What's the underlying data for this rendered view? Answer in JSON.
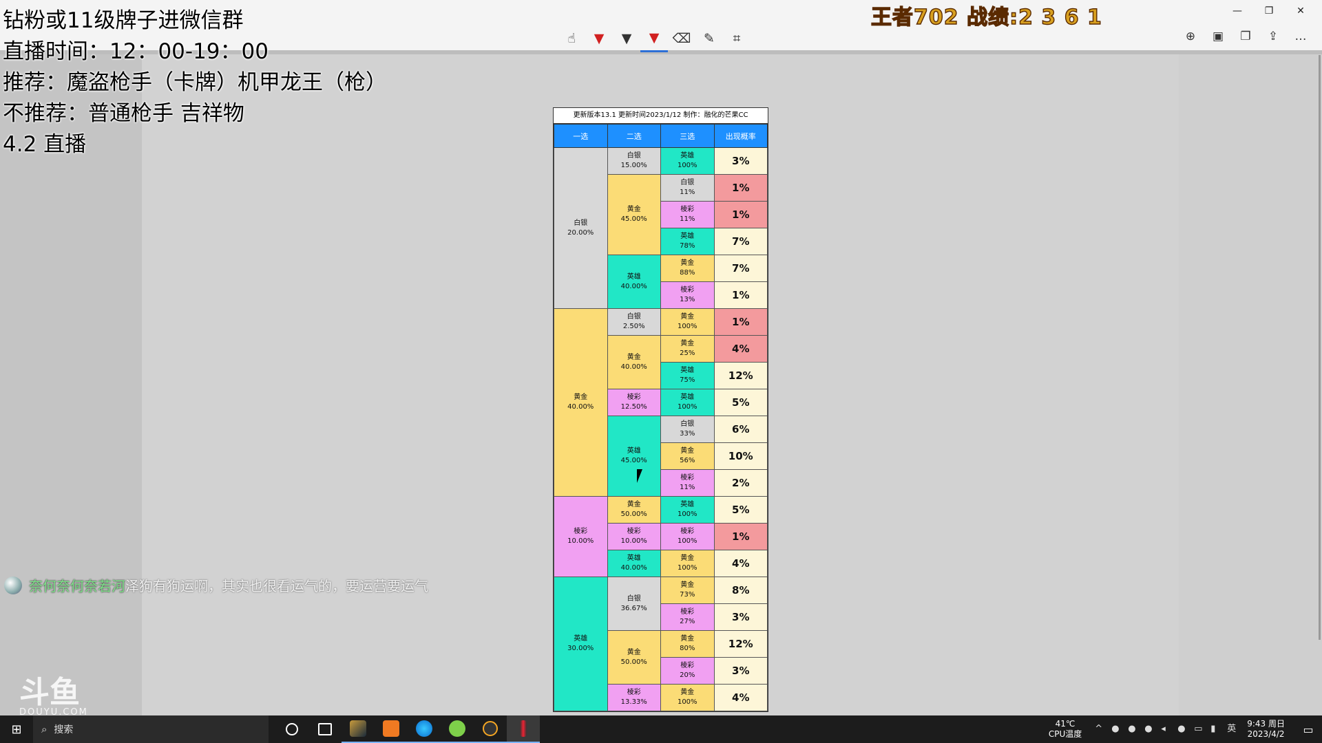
{
  "overlay": {
    "line1": "钻粉或11级牌子进微信群",
    "line2": "直播时间：12：00-19：00",
    "line3": "推荐：魔盗枪手（卡牌）机甲龙王（枪）",
    "line4": "不推荐：普通枪手 吉祥物",
    "line5": "4.2 直播",
    "score": "王者702 战绩:2 3 6 1"
  },
  "danmu": {
    "user": "奈何奈何奈若河",
    "text": "泽狗有狗运啊，其实也很看运气的，要运营要运气"
  },
  "watermark": {
    "logo": "斗鱼",
    "sub": "DOUYU.COM"
  },
  "toolbar": {
    "icons": [
      "touch-write-icon",
      "ballpoint-pen-icon",
      "pencil-icon",
      "highlighter-icon",
      "eraser-icon",
      "ruler-icon",
      "crop-icon"
    ],
    "right_icons": [
      "zoom-in-icon",
      "save-icon",
      "copy-icon",
      "share-icon",
      "more-icon"
    ]
  },
  "table": {
    "header": "更新版本13.1  更新时间2023/1/12  制作：融化的芒果CC",
    "columns": [
      "一选",
      "二选",
      "三选",
      "出现概率"
    ],
    "colors": {
      "silver": "#d8d8d8",
      "gold": "#fbdc76",
      "hero": "#21e7c6",
      "prism": "#f1a0f2",
      "high": "#f39a9d"
    },
    "groups": [
      {
        "name": "白银",
        "pct": "20.00%",
        "color": "silver",
        "seconds": [
          {
            "name": "白银",
            "pct": "15.00%",
            "color": "silver",
            "thirds": [
              {
                "name": "英雄",
                "pct": "100%",
                "color": "hero",
                "prob": "3%",
                "hi": false
              }
            ]
          },
          {
            "name": "黄金",
            "pct": "45.00%",
            "color": "gold",
            "thirds": [
              {
                "name": "白银",
                "pct": "11%",
                "color": "silver",
                "prob": "1%",
                "hi": true
              },
              {
                "name": "棱彩",
                "pct": "11%",
                "color": "prism",
                "prob": "1%",
                "hi": true
              },
              {
                "name": "英雄",
                "pct": "78%",
                "color": "hero",
                "prob": "7%",
                "hi": false
              }
            ]
          },
          {
            "name": "英雄",
            "pct": "40.00%",
            "color": "hero",
            "thirds": [
              {
                "name": "黄金",
                "pct": "88%",
                "color": "gold",
                "prob": "7%",
                "hi": false
              },
              {
                "name": "棱彩",
                "pct": "13%",
                "color": "prism",
                "prob": "1%",
                "hi": false
              }
            ]
          }
        ]
      },
      {
        "name": "黄金",
        "pct": "40.00%",
        "color": "gold",
        "seconds": [
          {
            "name": "白银",
            "pct": "2.50%",
            "color": "silver",
            "thirds": [
              {
                "name": "黄金",
                "pct": "100%",
                "color": "gold",
                "prob": "1%",
                "hi": true
              }
            ]
          },
          {
            "name": "黄金",
            "pct": "40.00%",
            "color": "gold",
            "thirds": [
              {
                "name": "黄金",
                "pct": "25%",
                "color": "gold",
                "prob": "4%",
                "hi": true
              },
              {
                "name": "英雄",
                "pct": "75%",
                "color": "hero",
                "prob": "12%",
                "hi": false
              }
            ]
          },
          {
            "name": "棱彩",
            "pct": "12.50%",
            "color": "prism",
            "thirds": [
              {
                "name": "英雄",
                "pct": "100%",
                "color": "hero",
                "prob": "5%",
                "hi": false
              }
            ]
          },
          {
            "name": "英雄",
            "pct": "45.00%",
            "color": "hero",
            "thirds": [
              {
                "name": "白银",
                "pct": "33%",
                "color": "silver",
                "prob": "6%",
                "hi": false
              },
              {
                "name": "黄金",
                "pct": "56%",
                "color": "gold",
                "prob": "10%",
                "hi": false
              },
              {
                "name": "棱彩",
                "pct": "11%",
                "color": "prism",
                "prob": "2%",
                "hi": false
              }
            ]
          }
        ]
      },
      {
        "name": "棱彩",
        "pct": "10.00%",
        "color": "prism",
        "seconds": [
          {
            "name": "黄金",
            "pct": "50.00%",
            "color": "gold",
            "thirds": [
              {
                "name": "英雄",
                "pct": "100%",
                "color": "hero",
                "prob": "5%",
                "hi": false
              }
            ]
          },
          {
            "name": "棱彩",
            "pct": "10.00%",
            "color": "prism",
            "thirds": [
              {
                "name": "棱彩",
                "pct": "100%",
                "color": "prism",
                "prob": "1%",
                "hi": true
              }
            ]
          },
          {
            "name": "英雄",
            "pct": "40.00%",
            "color": "hero",
            "thirds": [
              {
                "name": "黄金",
                "pct": "100%",
                "color": "gold",
                "prob": "4%",
                "hi": false
              }
            ]
          }
        ]
      },
      {
        "name": "英雄",
        "pct": "30.00%",
        "color": "hero",
        "seconds": [
          {
            "name": "白银",
            "pct": "36.67%",
            "color": "silver",
            "thirds": [
              {
                "name": "黄金",
                "pct": "73%",
                "color": "gold",
                "prob": "8%",
                "hi": false
              },
              {
                "name": "棱彩",
                "pct": "27%",
                "color": "prism",
                "prob": "3%",
                "hi": false
              }
            ]
          },
          {
            "name": "黄金",
            "pct": "50.00%",
            "color": "gold",
            "thirds": [
              {
                "name": "黄金",
                "pct": "80%",
                "color": "gold",
                "prob": "12%",
                "hi": false
              },
              {
                "name": "棱彩",
                "pct": "20%",
                "color": "prism",
                "prob": "3%",
                "hi": false
              }
            ]
          },
          {
            "name": "棱彩",
            "pct": "13.33%",
            "color": "prism",
            "thirds": [
              {
                "name": "黄金",
                "pct": "100%",
                "color": "gold",
                "prob": "4%",
                "hi": false
              }
            ]
          }
        ]
      }
    ]
  },
  "taskbar": {
    "search_placeholder": "搜索",
    "cpu_temp": "41℃",
    "cpu_label": "CPU温度",
    "ime": "英",
    "time": "9:43 周日",
    "date": "2023/4/2"
  }
}
